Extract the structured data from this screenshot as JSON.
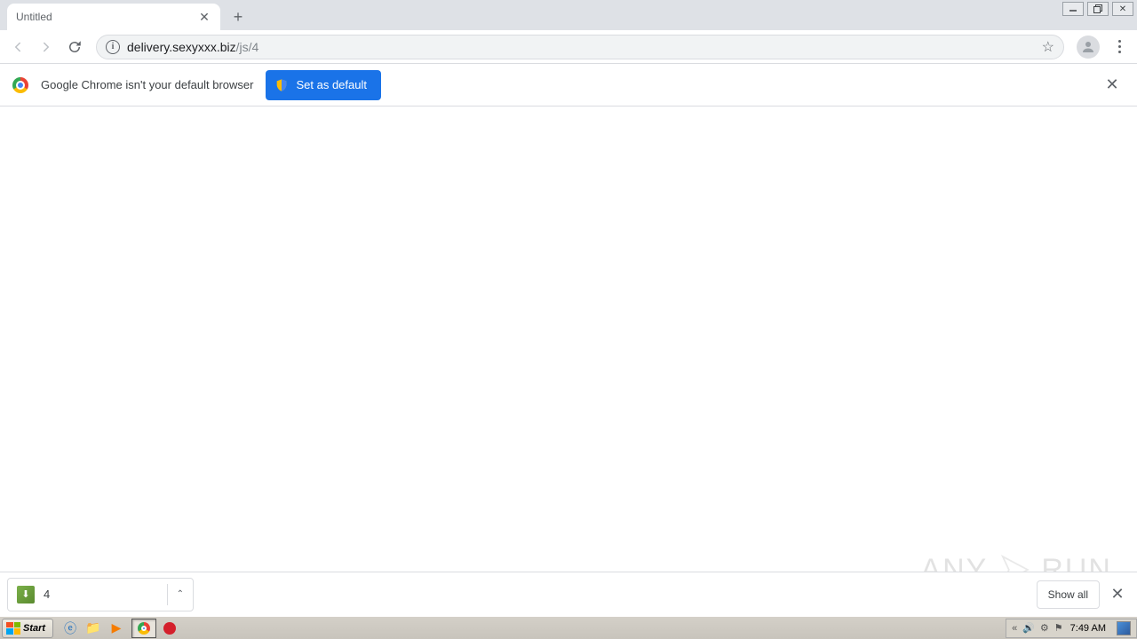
{
  "tab": {
    "title": "Untitled"
  },
  "url": {
    "host": "delivery.sexyxxx.biz",
    "path": "/js/4"
  },
  "infobar": {
    "message": "Google Chrome isn't your default browser",
    "button": "Set as default"
  },
  "downloads": {
    "item_name": "4",
    "show_all": "Show all"
  },
  "watermark": {
    "text_left": "ANY",
    "text_right": "RUN"
  },
  "taskbar": {
    "start": "Start",
    "clock": "7:49 AM"
  }
}
